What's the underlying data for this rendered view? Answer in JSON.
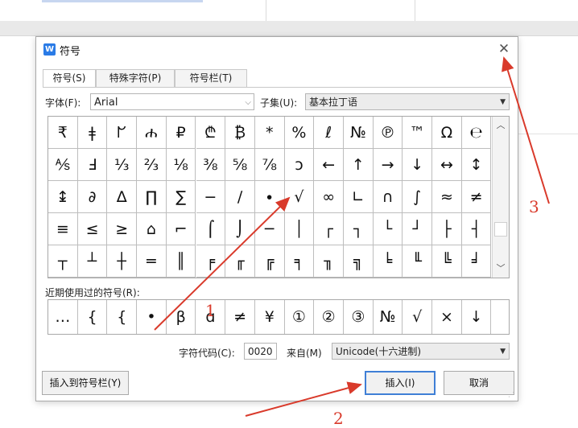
{
  "dialog": {
    "title": "符号",
    "tabs": [
      "符号(S)",
      "特殊字符(P)",
      "符号栏(T)"
    ],
    "font_label": "字体(F):",
    "font_value": "Arial",
    "subset_label": "子集(U):",
    "subset_value": "基本拉丁语",
    "symbols": [
      [
        "₹",
        "ǂ",
        "ᖸ",
        "ሐ",
        "₽",
        "₾",
        "₿",
        "*",
        "%",
        "ℓ",
        "№",
        "℗",
        "™",
        "Ω",
        "℮"
      ],
      [
        "⅍",
        "Ⅎ",
        "⅓",
        "⅔",
        "⅛",
        "⅜",
        "⅝",
        "⅞",
        "ↄ",
        "←",
        "↑",
        "→",
        "↓",
        "↔",
        "↕"
      ],
      [
        "↨",
        "∂",
        "∆",
        "∏",
        "∑",
        "−",
        "∕",
        "∙",
        "√",
        "∞",
        "∟",
        "∩",
        "∫",
        "≈",
        "≠"
      ],
      [
        "≡",
        "≤",
        "≥",
        "⌂",
        "⌐",
        "⌠",
        "⌡",
        "─",
        "│",
        "┌",
        "┐",
        "└",
        "┘",
        "├",
        "┤"
      ],
      [
        "┬",
        "┴",
        "┼",
        "═",
        "║",
        "╒",
        "╓",
        "╔",
        "╕",
        "╖",
        "╗",
        "╘",
        "╙",
        "╚",
        "╛"
      ]
    ],
    "recent_label": "近期使用过的符号(R):",
    "recent_symbols": [
      "…",
      "{",
      "{",
      "•",
      "β",
      "ɑ",
      "≠",
      "¥",
      "①",
      "②",
      "③",
      "№",
      "√",
      "×",
      "↓"
    ],
    "code_label": "字符代码(C):",
    "code_value": "0020",
    "from_label": "来自(M)",
    "from_value": "Unicode(十六进制)",
    "insert_to_bar_button": "插入到符号栏(Y)",
    "insert_button": "插入(I)",
    "cancel_button": "取消"
  },
  "annotations": {
    "label_1": "1",
    "label_2": "2",
    "label_3": "3",
    "color": "#d93a2b"
  },
  "icons": {
    "app": "wps-writer-icon",
    "close": "close-icon",
    "dropdown": "chevron-down-icon",
    "scroll_up": "scroll-up-icon",
    "scroll_down": "scroll-down-icon"
  }
}
